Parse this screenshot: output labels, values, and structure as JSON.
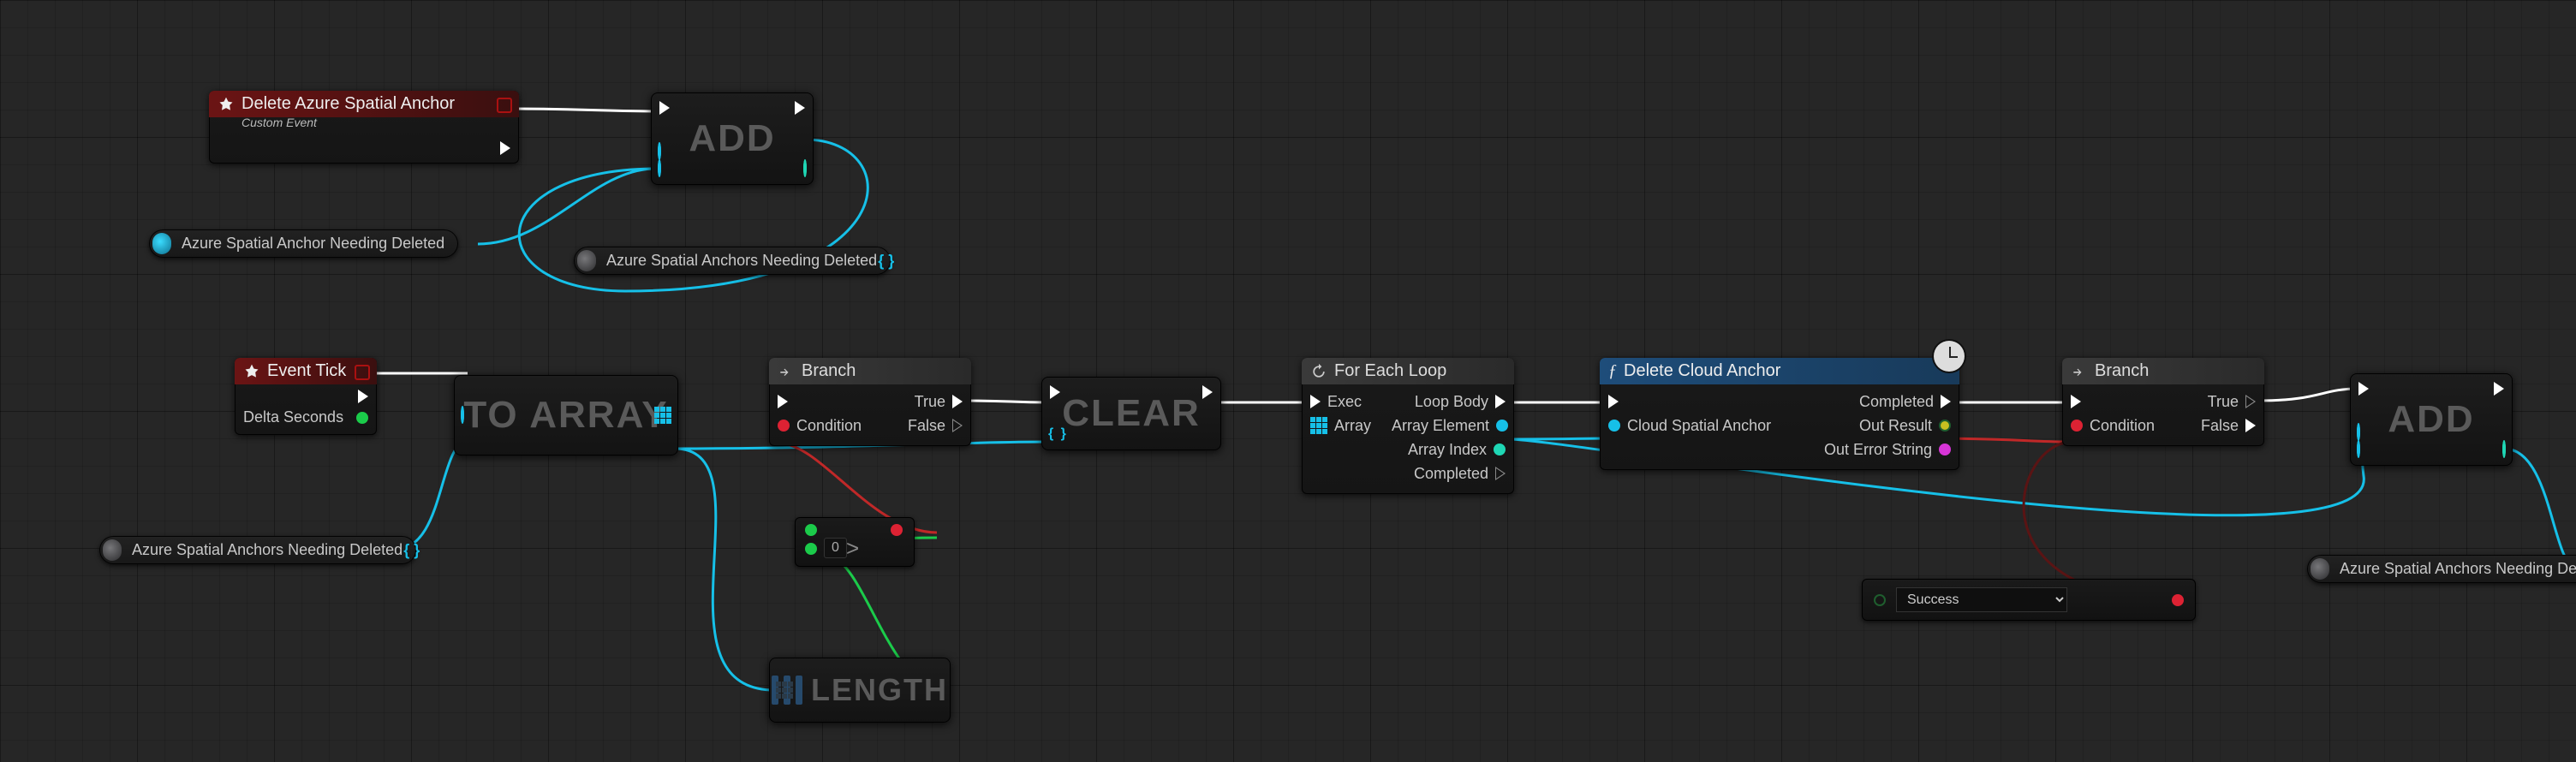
{
  "nodes": {
    "custom_event": {
      "title": "Delete Azure Spatial Anchor",
      "subtitle": "Custom Event"
    },
    "event_tick": {
      "title": "Event Tick",
      "pin_delta": "Delta Seconds"
    },
    "branch1": {
      "title": "Branch",
      "in_cond": "Condition",
      "out_true": "True",
      "out_false": "False"
    },
    "branch2": {
      "title": "Branch",
      "in_cond": "Condition",
      "out_true": "True",
      "out_false": "False"
    },
    "foreach": {
      "title": "For Each Loop",
      "in_exec": "Exec",
      "in_array": "Array",
      "out_body": "Loop Body",
      "out_elem": "Array Element",
      "out_idx": "Array Index",
      "out_done": "Completed"
    },
    "delete_cloud": {
      "title": "Delete Cloud Anchor",
      "in_anchor": "Cloud Spatial Anchor",
      "out_done": "Completed",
      "out_result": "Out Result",
      "out_err": "Out Error String"
    },
    "add1": {
      "title": "ADD"
    },
    "add2": {
      "title": "ADD"
    },
    "toarray": {
      "title": "TO ARRAY"
    },
    "clear": {
      "title": "CLEAR"
    },
    "length": {
      "title": "LENGTH"
    },
    "gt": {
      "value": "0"
    },
    "select": {
      "value": "Success"
    }
  },
  "pills": {
    "var_in_needed": "Azure Spatial Anchor Needing Deleted",
    "var_set_needed": "Azure Spatial Anchors Needing Deleted",
    "var_get_needed2": "Azure Spatial Anchors Needing Deleted",
    "var_set_needed2": "Azure Spatial Anchors Needing Deleted"
  },
  "colors": {
    "exec": "#ffffff",
    "cyan": "#16c0e8",
    "green": "#1bcb4a",
    "red": "#c02828",
    "darkred": "#5a1414"
  }
}
